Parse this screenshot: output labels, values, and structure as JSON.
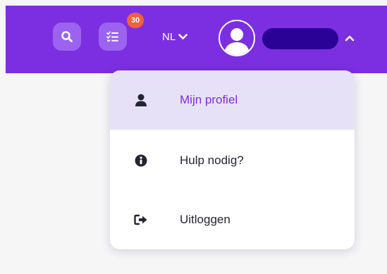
{
  "header": {
    "notification_count": "30",
    "language": "NL",
    "icons": [
      "search-icon",
      "tasks-icon",
      "chevron-down-icon",
      "user-avatar-icon",
      "chevron-up-icon"
    ]
  },
  "user_menu": {
    "items": [
      {
        "label": "Mijn profiel",
        "icon": "user-icon",
        "active": true
      },
      {
        "label": "Hulp nodig?",
        "icon": "info-icon",
        "active": false
      },
      {
        "label": "Uitloggen",
        "icon": "logout-icon",
        "active": false
      }
    ]
  },
  "colors": {
    "brand_purple": "#7c2fe0",
    "button_purple": "#9b63f0",
    "badge_orange": "#f0613c",
    "active_item_bg": "#e7e1f8",
    "redaction": "#2a0296"
  }
}
